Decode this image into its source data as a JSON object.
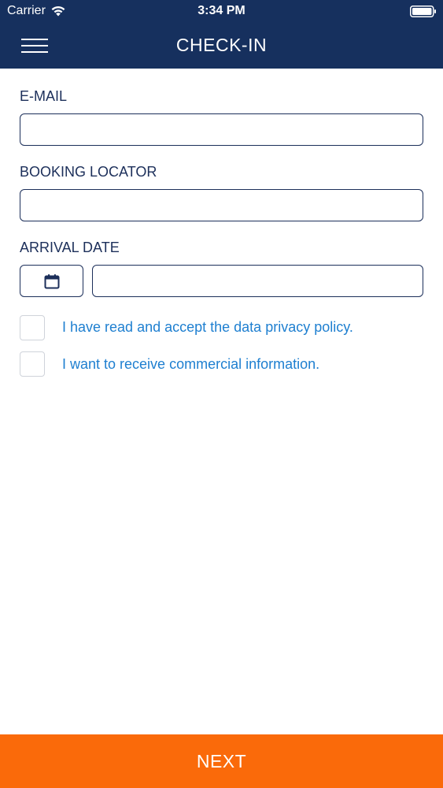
{
  "status_bar": {
    "carrier": "Carrier",
    "time": "3:34 PM"
  },
  "header": {
    "title": "CHECK-IN",
    "menu_icon": "hamburger-menu-icon"
  },
  "form": {
    "email": {
      "label": "E-MAIL",
      "value": "",
      "placeholder": ""
    },
    "booking_locator": {
      "label": "BOOKING LOCATOR",
      "value": "",
      "placeholder": ""
    },
    "arrival_date": {
      "label": "ARRIVAL DATE",
      "value": "",
      "placeholder": "",
      "button_icon": "calendar-icon"
    },
    "checkboxes": [
      {
        "label": "I have read and accept the data privacy policy.",
        "checked": false
      },
      {
        "label": "I want to receive commercial information.",
        "checked": false
      }
    ]
  },
  "footer": {
    "next_label": "NEXT"
  },
  "colors": {
    "header_bg": "#16305e",
    "label_text": "#1c2f5a",
    "link_text": "#1e7fd0",
    "primary_button": "#fa6a0a"
  }
}
